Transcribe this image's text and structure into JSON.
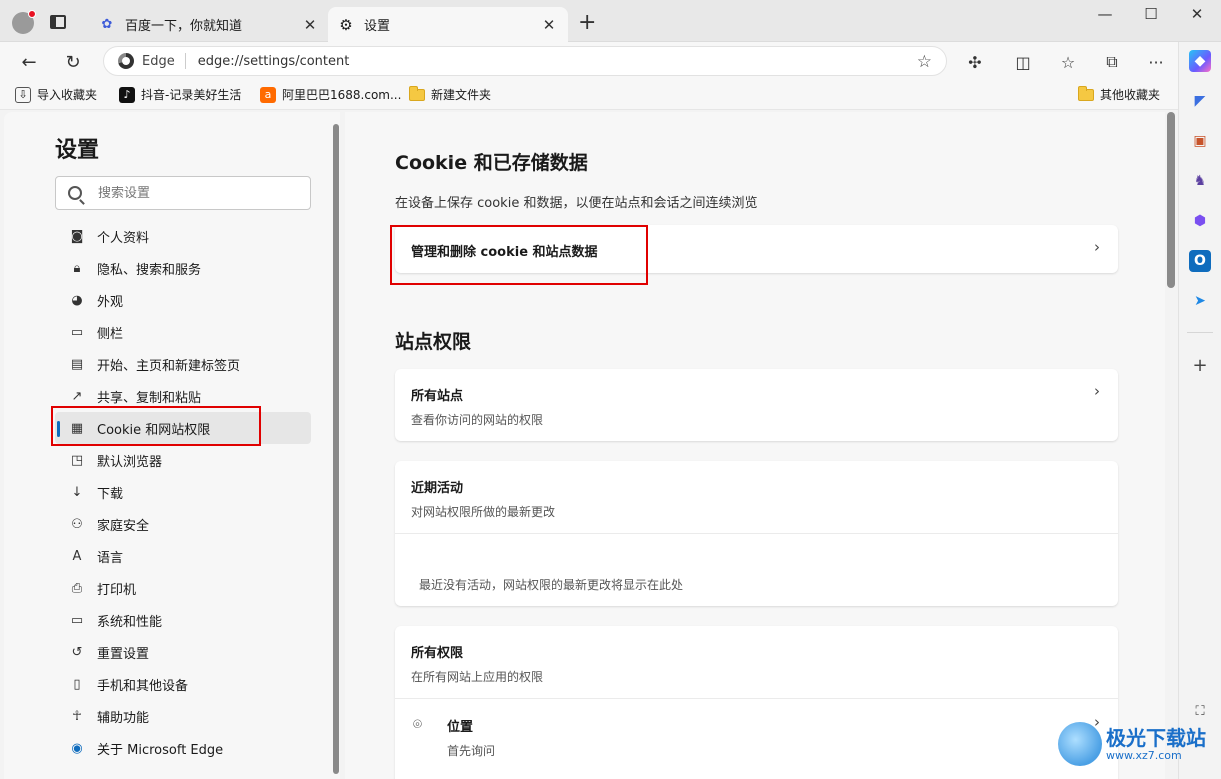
{
  "tabs": [
    {
      "title": "百度一下，你就知道"
    },
    {
      "title": "设置"
    }
  ],
  "address": {
    "brand": "Edge",
    "url": "edge://settings/content"
  },
  "bookmarks": [
    {
      "label": "导入收藏夹"
    },
    {
      "label": "抖音-记录美好生活"
    },
    {
      "label": "阿里巴巴1688.com..."
    },
    {
      "label": "新建文件夹"
    }
  ],
  "other_bookmarks": "其他收藏夹",
  "settings": {
    "title": "设置",
    "search_placeholder": "搜索设置",
    "nav": [
      {
        "label": "个人资料",
        "icon": "profile-icon"
      },
      {
        "label": "隐私、搜索和服务",
        "icon": "lock-icon"
      },
      {
        "label": "外观",
        "icon": "palette-icon"
      },
      {
        "label": "侧栏",
        "icon": "sidebar-icon"
      },
      {
        "label": "开始、主页和新建标签页",
        "icon": "home-icon"
      },
      {
        "label": "共享、复制和粘贴",
        "icon": "share-icon"
      },
      {
        "label": "Cookie 和网站权限",
        "icon": "cookie-icon",
        "active": true
      },
      {
        "label": "默认浏览器",
        "icon": "browser-icon"
      },
      {
        "label": "下载",
        "icon": "download-icon"
      },
      {
        "label": "家庭安全",
        "icon": "family-icon"
      },
      {
        "label": "语言",
        "icon": "language-icon"
      },
      {
        "label": "打印机",
        "icon": "printer-icon"
      },
      {
        "label": "系统和性能",
        "icon": "system-icon"
      },
      {
        "label": "重置设置",
        "icon": "reset-icon"
      },
      {
        "label": "手机和其他设备",
        "icon": "phone-icon"
      },
      {
        "label": "辅助功能",
        "icon": "accessibility-icon"
      },
      {
        "label": "关于 Microsoft Edge",
        "icon": "edge-icon"
      }
    ]
  },
  "content": {
    "cookie_heading": "Cookie 和已存储数据",
    "cookie_desc": "在设备上保存 cookie 和数据，以便在站点和会话之间连续浏览",
    "manage_cookies": "管理和删除 cookie 和站点数据",
    "permissions_heading": "站点权限",
    "all_sites_title": "所有站点",
    "all_sites_sub": "查看你访问的网站的权限",
    "recent_title": "近期活动",
    "recent_sub": "对网站权限所做的最新更改",
    "recent_empty": "最近没有活动，网站权限的最新更改将显示在此处",
    "all_perms_title": "所有权限",
    "all_perms_sub": "在所有网站上应用的权限",
    "location_title": "位置",
    "location_sub": "首先询问"
  },
  "watermark": {
    "line1": "极光下载站",
    "line2": "www.xz7.com"
  }
}
